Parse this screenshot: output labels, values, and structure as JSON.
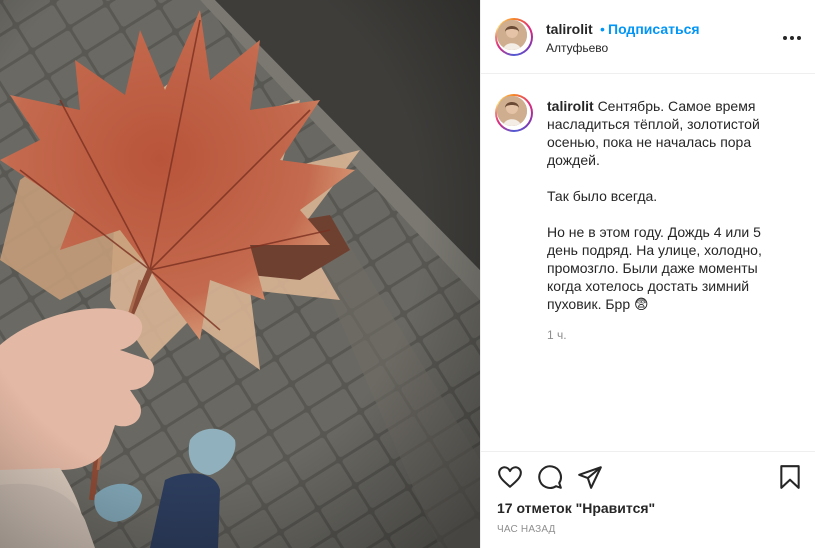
{
  "post": {
    "photo_name": "autumn maple leaf bouquet",
    "header": {
      "username": "talirolit",
      "separator": "•",
      "follow_label": "Подписаться",
      "location": "Алтуфьево",
      "more_icon": "more-horizontal-icon"
    },
    "caption": {
      "username": "talirolit",
      "text_p1": "Сентябрь. Самое время насладиться тёплой, золотистой осенью, пока не началась пора дождей.",
      "text_p2": "Так было всегда.",
      "text_p3": "Но не в этом году. Дождь 4 или 5 день подряд. На улице, холодно, промозгло. Были даже моменты когда хотелось достать зимний пуховик. Брр",
      "emoji": "😨",
      "time": "1 ч."
    },
    "actions": {
      "like_icon": "heart-icon",
      "comment_icon": "comment-icon",
      "share_icon": "share-icon",
      "save_icon": "bookmark-icon"
    },
    "likes_text": "17 отметок \"Нравится\"",
    "posted_time": "ЧАС НАЗАД"
  },
  "colors": {
    "accent": "#0095f6",
    "text": "#262626",
    "muted": "#8e8e8e",
    "border": "#efefef"
  }
}
